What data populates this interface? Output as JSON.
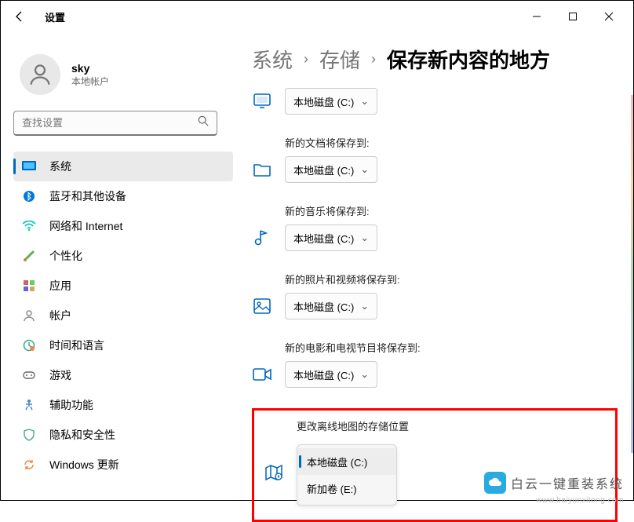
{
  "window": {
    "title": "设置"
  },
  "user": {
    "name": "sky",
    "type": "本地帐户"
  },
  "search": {
    "placeholder": "查找设置"
  },
  "nav": {
    "items": [
      {
        "label": "系统",
        "selected": true
      },
      {
        "label": "蓝牙和其他设备"
      },
      {
        "label": "网络和 Internet"
      },
      {
        "label": "个性化"
      },
      {
        "label": "应用"
      },
      {
        "label": "帐户"
      },
      {
        "label": "时间和语言"
      },
      {
        "label": "游戏"
      },
      {
        "label": "辅助功能"
      },
      {
        "label": "隐私和安全性"
      },
      {
        "label": "Windows 更新"
      }
    ]
  },
  "breadcrumb": {
    "a": "系统",
    "b": "存储",
    "c": "保存新内容的地方"
  },
  "sections": [
    {
      "label": "",
      "value": "本地磁盘 (C:)"
    },
    {
      "label": "新的文档将保存到:",
      "value": "本地磁盘 (C:)"
    },
    {
      "label": "新的音乐将保存到:",
      "value": "本地磁盘 (C:)"
    },
    {
      "label": "新的照片和视频将保存到:",
      "value": "本地磁盘 (C:)"
    },
    {
      "label": "新的电影和电视节目将保存到:",
      "value": "本地磁盘 (C:)"
    }
  ],
  "maps": {
    "label": "更改离线地图的存储位置",
    "options": [
      {
        "label": "本地磁盘 (C:)",
        "hover": true
      },
      {
        "label": "新加卷 (E:)"
      }
    ]
  },
  "watermark": {
    "text": "白云一键重装系统",
    "url": "www.baiyunxitong.com"
  }
}
